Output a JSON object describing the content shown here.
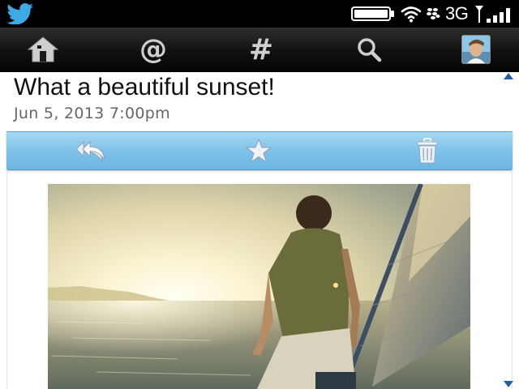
{
  "status_bar": {
    "app_icon": "twitter-bird-icon",
    "network": "3G",
    "icons": [
      "battery-icon",
      "wifi-icon",
      "bbm-icon",
      "signal-bars-icon"
    ]
  },
  "nav": {
    "items": [
      {
        "name": "home",
        "icon": "home-icon"
      },
      {
        "name": "mentions",
        "icon": "at-icon",
        "glyph": "@"
      },
      {
        "name": "trends",
        "icon": "hashtag-icon",
        "glyph": "#"
      },
      {
        "name": "search",
        "icon": "search-icon"
      },
      {
        "name": "profile",
        "icon": "avatar"
      }
    ]
  },
  "post": {
    "title": "What a beautiful sunset!",
    "date": "Jun 5, 2013 7:00pm"
  },
  "actions": [
    {
      "name": "reply",
      "icon": "reply-icon"
    },
    {
      "name": "favorite",
      "icon": "star-icon"
    },
    {
      "name": "delete",
      "icon": "trash-icon"
    }
  ],
  "colors": {
    "twitter_blue": "#1da1f2",
    "action_bar": "#7ec2e9",
    "nav_bar": "#111111"
  }
}
